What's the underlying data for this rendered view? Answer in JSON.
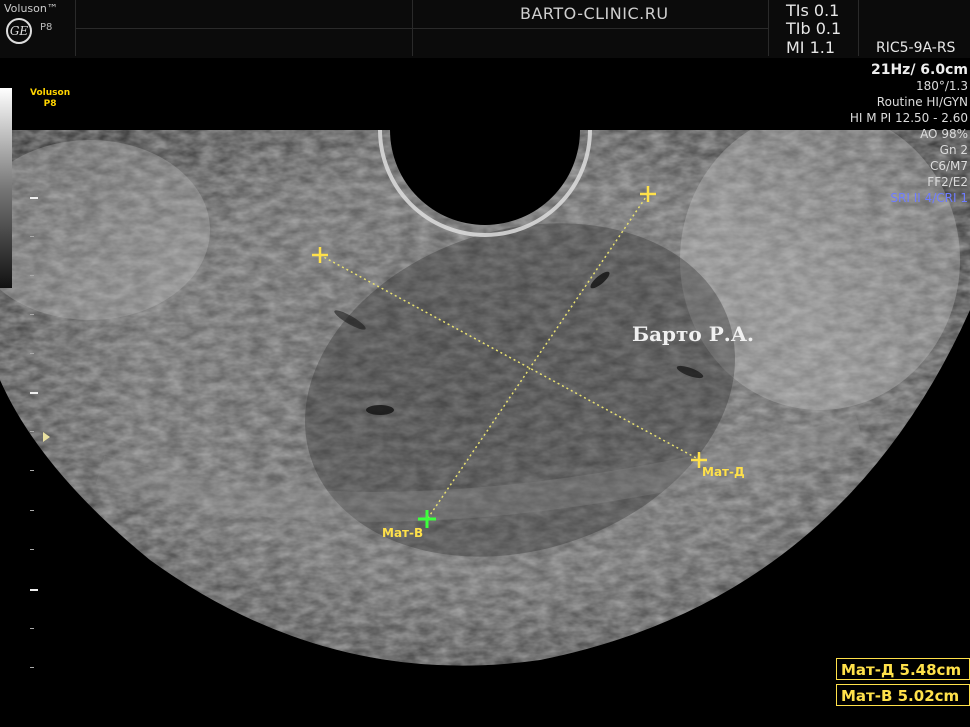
{
  "header": {
    "brand": "Voluson™",
    "logo": "GE",
    "model": "P8",
    "clinic": "BARTO-CLINIC.RU",
    "tis": "TIs 0.1",
    "tib": "TIb 0.1",
    "mi": "MI  1.1",
    "probe": "RIC5-9A-RS"
  },
  "left_panel": {
    "brand": "Voluson",
    "model": "P8"
  },
  "params": {
    "freq": "21Hz/ 6.0cm",
    "angle": "180°/1.3",
    "preset": "Routine HI/GYN",
    "pi": "HI M PI 12.50 - 2.60",
    "ao": "AO 98%",
    "gn": "Gn   2",
    "c": "C6/M7",
    "ff": "FF2/E2",
    "sri": "SRI II 4/CRI 1"
  },
  "watermark": "Барто Р.А.",
  "calipers": {
    "d_label": "Мат-Д",
    "v_label": "Мат-В"
  },
  "measurements": {
    "d": "Мат-Д 5.48cm",
    "v": "Мат-В 5.02cm"
  },
  "colors": {
    "caliper_yellow": "#ffe14a",
    "caliper_green": "#3cff3c",
    "sri_blue": "#6e7cff"
  }
}
